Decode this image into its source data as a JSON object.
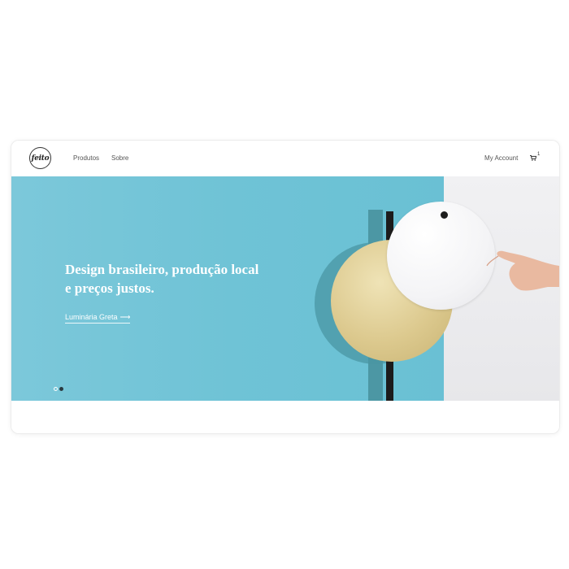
{
  "brand": {
    "logo_text": "feito"
  },
  "nav": {
    "items": [
      {
        "label": "Produtos"
      },
      {
        "label": "Sobre"
      }
    ],
    "account_label": "My Account",
    "cart_count": "1"
  },
  "hero": {
    "headline_line1": "Design brasileiro, produção local",
    "headline_line2": "e preços justos.",
    "link_label": "Luminária Greta",
    "link_arrow": "⟶",
    "slides_total": 2,
    "active_slide": 1
  },
  "colors": {
    "hero_background": "#6fc3d6",
    "wall": "#ececef",
    "brass": "#dcc98e",
    "pole": "#1c1c1c",
    "text_light": "#ffffff",
    "nav_text": "#555555"
  },
  "icons": {
    "cart": "cart-icon",
    "logo": "feito-logo",
    "arrow": "arrow-right-icon"
  }
}
